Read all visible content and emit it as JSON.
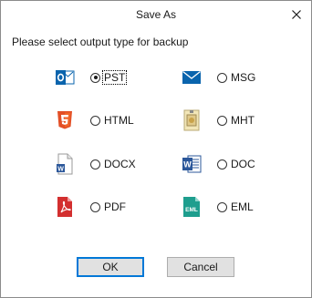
{
  "dialog": {
    "title": "Save As",
    "prompt": "Please select output type for backup"
  },
  "options": [
    {
      "label": "PST",
      "icon": "outlook-icon",
      "checked": true
    },
    {
      "label": "MSG",
      "icon": "envelope-icon",
      "checked": false
    },
    {
      "label": "HTML",
      "icon": "html5-icon",
      "checked": false
    },
    {
      "label": "MHT",
      "icon": "mht-file-icon",
      "checked": false
    },
    {
      "label": "DOCX",
      "icon": "docx-file-icon",
      "checked": false
    },
    {
      "label": "DOC",
      "icon": "word-doc-icon",
      "checked": false
    },
    {
      "label": "PDF",
      "icon": "pdf-icon",
      "checked": false
    },
    {
      "label": "EML",
      "icon": "eml-file-icon",
      "checked": false
    }
  ],
  "buttons": {
    "ok": "OK",
    "cancel": "Cancel"
  },
  "colors": {
    "accent": "#0078d7",
    "outlook": "#0a64ad",
    "html5": "#e34f26",
    "pdf": "#d32f2f",
    "eml": "#1e9e8e"
  }
}
